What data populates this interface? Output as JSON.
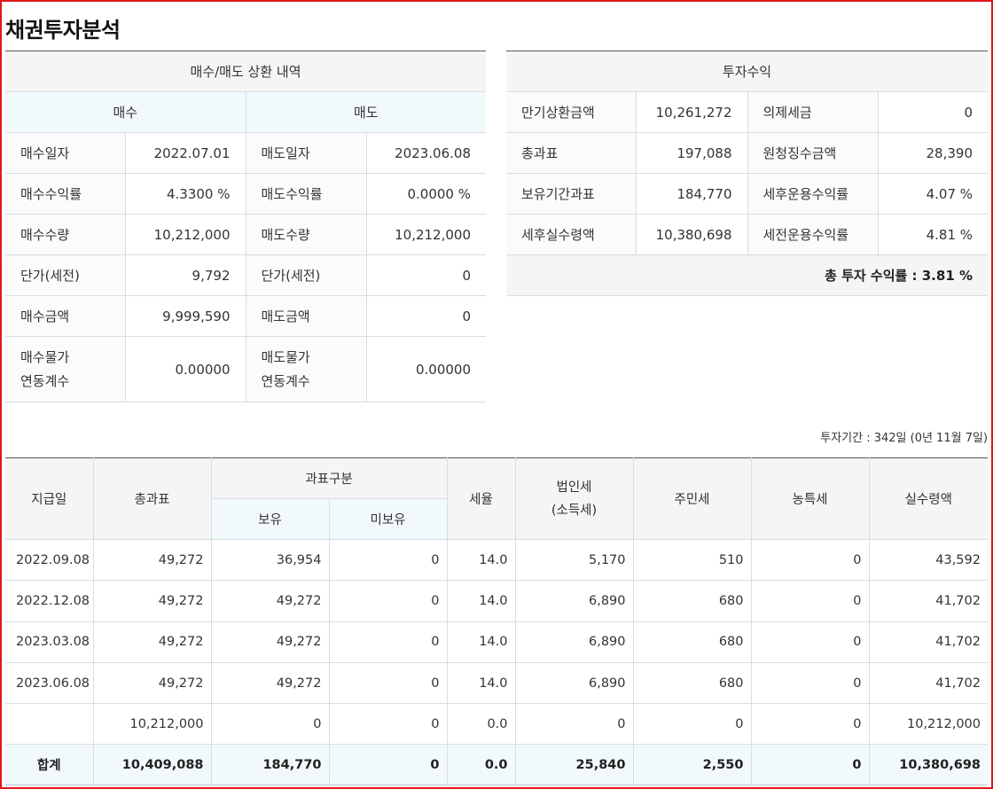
{
  "page_title": "채권투자분석",
  "trade": {
    "section_title": "매수/매도 상환 내역",
    "buy_header": "매수",
    "sell_header": "매도",
    "rows": [
      {
        "buy_label": "매수일자",
        "buy_value": "2022.07.01",
        "sell_label": "매도일자",
        "sell_value": "2023.06.08"
      },
      {
        "buy_label": "매수수익률",
        "buy_value": "4.3300 %",
        "sell_label": "매도수익률",
        "sell_value": "0.0000 %"
      },
      {
        "buy_label": "매수수량",
        "buy_value": "10,212,000",
        "sell_label": "매도수량",
        "sell_value": "10,212,000"
      },
      {
        "buy_label": "단가(세전)",
        "buy_value": "9,792",
        "sell_label": "단가(세전)",
        "sell_value": "0"
      },
      {
        "buy_label": "매수금액",
        "buy_value": "9,999,590",
        "sell_label": "매도금액",
        "sell_value": "0"
      }
    ],
    "last_row": {
      "buy_label_1": "매수물가",
      "buy_label_2": "연동계수",
      "buy_value": "0.00000",
      "sell_label_1": "매도물가",
      "sell_label_2": "연동계수",
      "sell_value": "0.00000"
    }
  },
  "returns": {
    "section_title": "투자수익",
    "rows": [
      {
        "label1": "만기상환금액",
        "value1": "10,261,272",
        "label2": "의제세금",
        "value2": "0"
      },
      {
        "label1": "총과표",
        "value1": "197,088",
        "label2": "원청징수금액",
        "value2": "28,390"
      },
      {
        "label1": "보유기간과표",
        "value1": "184,770",
        "label2": "세후운용수익률",
        "value2": "4.07 %"
      },
      {
        "label1": "세후실수령액",
        "value1": "10,380,698",
        "label2": "세전운용수익률",
        "value2": "4.81 %"
      }
    ],
    "total_return": "총 투자 수익률 : 3.81 %"
  },
  "period_text": "투자기간 : 342일 (0년 11월 7일)",
  "payments": {
    "headers": {
      "date": "지급일",
      "total_tax_base": "총과표",
      "tax_base_group": "과표구분",
      "held": "보유",
      "not_held": "미보유",
      "tax_rate": "세율",
      "corp_tax_1": "법인세",
      "corp_tax_2": "(소득세)",
      "resident_tax": "주민세",
      "rural_tax": "농특세",
      "net_received": "실수령액"
    },
    "rows": [
      {
        "date": "2022.09.08",
        "total": "49,272",
        "held": "36,954",
        "not_held": "0",
        "rate": "14.0",
        "corp": "5,170",
        "resident": "510",
        "rural": "0",
        "net": "43,592"
      },
      {
        "date": "2022.12.08",
        "total": "49,272",
        "held": "49,272",
        "not_held": "0",
        "rate": "14.0",
        "corp": "6,890",
        "resident": "680",
        "rural": "0",
        "net": "41,702"
      },
      {
        "date": "2023.03.08",
        "total": "49,272",
        "held": "49,272",
        "not_held": "0",
        "rate": "14.0",
        "corp": "6,890",
        "resident": "680",
        "rural": "0",
        "net": "41,702"
      },
      {
        "date": "2023.06.08",
        "total": "49,272",
        "held": "49,272",
        "not_held": "0",
        "rate": "14.0",
        "corp": "6,890",
        "resident": "680",
        "rural": "0",
        "net": "41,702"
      },
      {
        "date": "",
        "total": "10,212,000",
        "held": "0",
        "not_held": "0",
        "rate": "0.0",
        "corp": "0",
        "resident": "0",
        "rural": "0",
        "net": "10,212,000"
      }
    ],
    "sum": {
      "label": "합계",
      "total": "10,409,088",
      "held": "184,770",
      "not_held": "0",
      "rate": "0.0",
      "corp": "25,840",
      "resident": "2,550",
      "rural": "0",
      "net": "10,380,698"
    }
  }
}
